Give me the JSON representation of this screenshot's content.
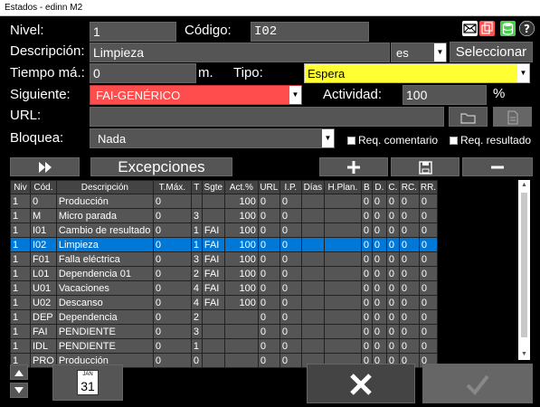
{
  "window": {
    "title": "Estados - edinn M2"
  },
  "form": {
    "nivel_label": "Nivel:",
    "nivel_value": "1",
    "codigo_label": "Código:",
    "codigo_value": "I02",
    "descripcion_label": "Descripción:",
    "descripcion_value": "Limpieza",
    "lang_value": "es",
    "seleccionar_label": "Seleccionar",
    "tiempo_label": "Tiempo má.:",
    "tiempo_value": "0",
    "tiempo_unit": "m.",
    "tipo_label": "Tipo:",
    "tipo_value": "Espera",
    "siguiente_label": "Siguiente:",
    "siguiente_value": "FAI-GENÉRICO",
    "actividad_label": "Actividad:",
    "actividad_value": "100",
    "actividad_unit": "%",
    "url_label": "URL:",
    "url_value": "",
    "bloquea_label": "Bloquea:",
    "bloquea_value": "Nada",
    "req_comentario_label": "Req. comentario",
    "req_resultado_label": "Req. resultado"
  },
  "toolbar": {
    "excepciones_label": "Excepciones"
  },
  "colors": {
    "tipo_bg": "#ffff33",
    "siguiente_bg": "#ff4d4d",
    "selected_row": "#0078d7"
  },
  "table": {
    "headers": [
      "Niv",
      "Cód.",
      "Descripción",
      "T.Máx.",
      "T",
      "Sgte",
      "Act.%",
      "URL",
      "I.P.",
      "Días",
      "H.Plan.",
      "B",
      "D.",
      "C.",
      "RC.",
      "RR."
    ],
    "rows": [
      [
        "1",
        "0",
        "Producción",
        "0",
        "",
        "",
        "100",
        "0",
        "0",
        "",
        "",
        "0",
        "0",
        "0",
        "0",
        "0"
      ],
      [
        "1",
        "M",
        "Micro parada",
        "0",
        "3",
        "",
        "100",
        "0",
        "0",
        "",
        "",
        "0",
        "0",
        "0",
        "0",
        "0"
      ],
      [
        "1",
        "I01",
        "Cambio de resultado",
        "0",
        "1",
        "FAI",
        "100",
        "0",
        "0",
        "",
        "",
        "0",
        "0",
        "0",
        "0",
        "0"
      ],
      [
        "1",
        "I02",
        "Limpieza",
        "0",
        "1",
        "FAI",
        "100",
        "0",
        "0",
        "",
        "",
        "0",
        "0",
        "0",
        "0",
        "0"
      ],
      [
        "1",
        "F01",
        "Falla eléctrica",
        "0",
        "3",
        "FAI",
        "100",
        "0",
        "0",
        "",
        "",
        "0",
        "0",
        "0",
        "0",
        "0"
      ],
      [
        "1",
        "L01",
        "Dependencia 01",
        "0",
        "2",
        "FAI",
        "100",
        "0",
        "0",
        "",
        "",
        "0",
        "0",
        "0",
        "0",
        "0"
      ],
      [
        "1",
        "U01",
        "Vacaciones",
        "0",
        "4",
        "FAI",
        "100",
        "0",
        "0",
        "",
        "",
        "0",
        "0",
        "0",
        "0",
        "0"
      ],
      [
        "1",
        "U02",
        "Descanso",
        "0",
        "4",
        "FAI",
        "100",
        "0",
        "0",
        "",
        "",
        "0",
        "0",
        "0",
        "0",
        "0"
      ],
      [
        "1",
        "DEP",
        "Dependencia",
        "0",
        "2",
        "",
        "",
        "0",
        "0",
        "",
        "",
        "0",
        "0",
        "0",
        "0",
        "0"
      ],
      [
        "1",
        "FAI",
        "PENDIENTE",
        "0",
        "3",
        "",
        "",
        "0",
        "0",
        "",
        "",
        "0",
        "0",
        "0",
        "0",
        "0"
      ],
      [
        "1",
        "IDL",
        "PENDIENTE",
        "0",
        "1",
        "",
        "",
        "0",
        "0",
        "",
        "",
        "0",
        "0",
        "0",
        "0",
        "0"
      ],
      [
        "1",
        "PRO",
        "Producción",
        "0",
        "0",
        "",
        "",
        "0",
        "0",
        "",
        "",
        "0",
        "0",
        "0",
        "0",
        "0"
      ]
    ],
    "selected_index": 3
  },
  "calendar": {
    "month": "JAN",
    "day": "31"
  }
}
